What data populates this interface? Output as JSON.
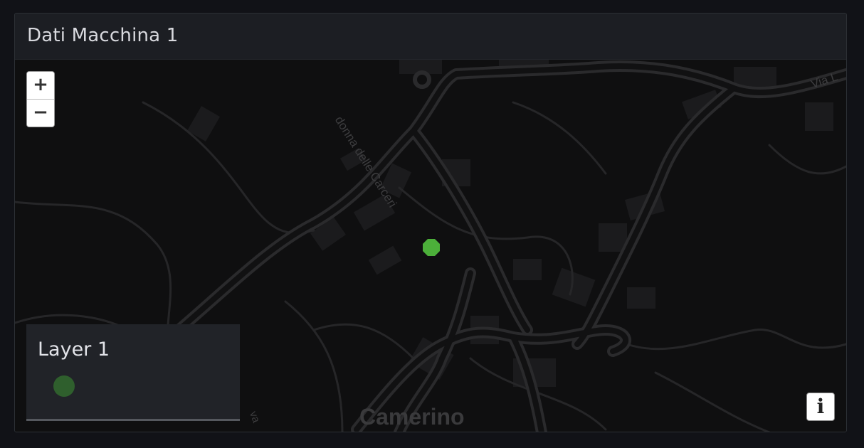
{
  "panel": {
    "title": "Dati Macchina 1"
  },
  "map": {
    "zoom_in_label": "+",
    "zoom_out_label": "−",
    "labels": {
      "street_1": "donna delle Carceri",
      "street_2": "Via L",
      "street_3": "va",
      "town": "Camerino"
    },
    "marker": {
      "color": "#4caf3a"
    },
    "info_label": "i"
  },
  "legend": {
    "title": "Layer 1",
    "dot_color": "#2f5f2d"
  }
}
